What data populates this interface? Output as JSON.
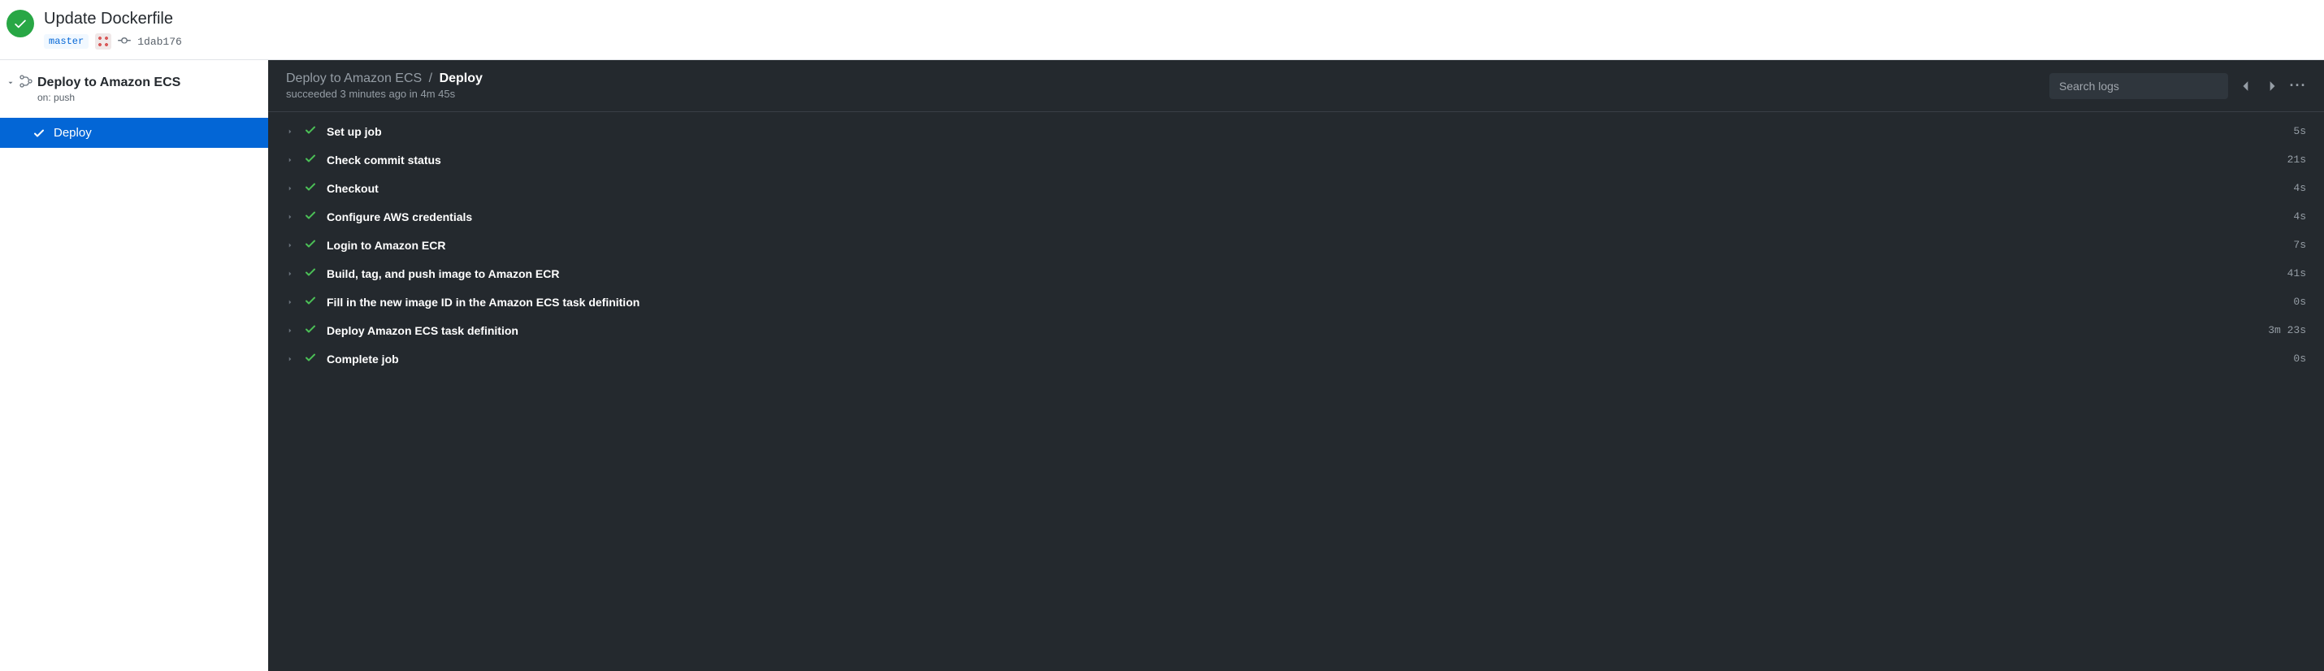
{
  "header": {
    "commit_title": "Update Dockerfile",
    "branch": "master",
    "commit_sha": "1dab176"
  },
  "sidebar": {
    "workflow_name": "Deploy to Amazon ECS",
    "trigger_text": "on: push",
    "job_name": "Deploy"
  },
  "main": {
    "breadcrumb_workflow": "Deploy to Amazon ECS",
    "breadcrumb_sep": "/",
    "breadcrumb_job": "Deploy",
    "run_status": "succeeded 3 minutes ago in 4m 45s",
    "search_placeholder": "Search logs",
    "kebab": "···"
  },
  "steps": [
    {
      "name": "Set up job",
      "duration": "5s"
    },
    {
      "name": "Check commit status",
      "duration": "21s"
    },
    {
      "name": "Checkout",
      "duration": "4s"
    },
    {
      "name": "Configure AWS credentials",
      "duration": "4s"
    },
    {
      "name": "Login to Amazon ECR",
      "duration": "7s"
    },
    {
      "name": "Build, tag, and push image to Amazon ECR",
      "duration": "41s"
    },
    {
      "name": "Fill in the new image ID in the Amazon ECS task definition",
      "duration": "0s"
    },
    {
      "name": "Deploy Amazon ECS task definition",
      "duration": "3m 23s"
    },
    {
      "name": "Complete job",
      "duration": "0s"
    }
  ]
}
